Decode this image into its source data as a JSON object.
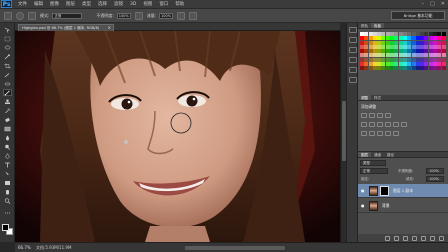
{
  "app": {
    "logo": "Ps"
  },
  "menu": {
    "items": [
      "文件",
      "编辑",
      "图像",
      "图层",
      "类型",
      "选择",
      "滤镜",
      "3D",
      "视图",
      "窗口",
      "帮助"
    ]
  },
  "window_controls": {
    "minimize": "–",
    "maximize": "□",
    "close": "✕"
  },
  "options": {
    "mode_label": "模式:",
    "mode_value": "正常",
    "opacity_label": "不透明度:",
    "opacity_value": "100%",
    "flow_label": "流量:",
    "flow_value": "100%",
    "workspace": "Bridge 基本功能"
  },
  "document": {
    "tab_title": "Highgian.psd @ 66.7% (图层 1 副本, RGB/8)",
    "tab_close": "×"
  },
  "status": {
    "zoom": "66.7%",
    "doc_info": "文档:5.93M/11.9M"
  },
  "panels": {
    "top_tabs": [
      "颜色",
      "色板"
    ],
    "adjust_tabs": [
      "调整",
      "样式"
    ],
    "adjust_title": "添加调整",
    "layer_tabs": [
      "图层",
      "通道",
      "路径"
    ],
    "kind_label": "类型",
    "blend_mode": "正常",
    "opacity_label": "不透明度:",
    "opacity_value": "100%",
    "lock_label": "锁定:",
    "fill_label": "填充:",
    "fill_value": "100%",
    "layers": [
      {
        "name": "图层 1 副本",
        "selected": true
      },
      {
        "name": "背景",
        "selected": false
      }
    ]
  },
  "colors": {
    "accent_selected_layer": "#6f8bb0",
    "ui_dark": "#282828",
    "panel": "#535353"
  },
  "icons": {
    "tools": [
      "move-tool-icon",
      "marquee-tool-icon",
      "lasso-tool-icon",
      "quick-select-tool-icon",
      "crop-tool-icon",
      "eyedropper-tool-icon",
      "healing-brush-tool-icon",
      "brush-tool-icon",
      "clone-stamp-tool-icon",
      "history-brush-tool-icon",
      "eraser-tool-icon",
      "gradient-tool-icon",
      "blur-tool-icon",
      "dodge-tool-icon",
      "pen-tool-icon",
      "type-tool-icon",
      "path-select-tool-icon",
      "shape-tool-icon",
      "hand-tool-icon",
      "zoom-tool-icon"
    ]
  }
}
